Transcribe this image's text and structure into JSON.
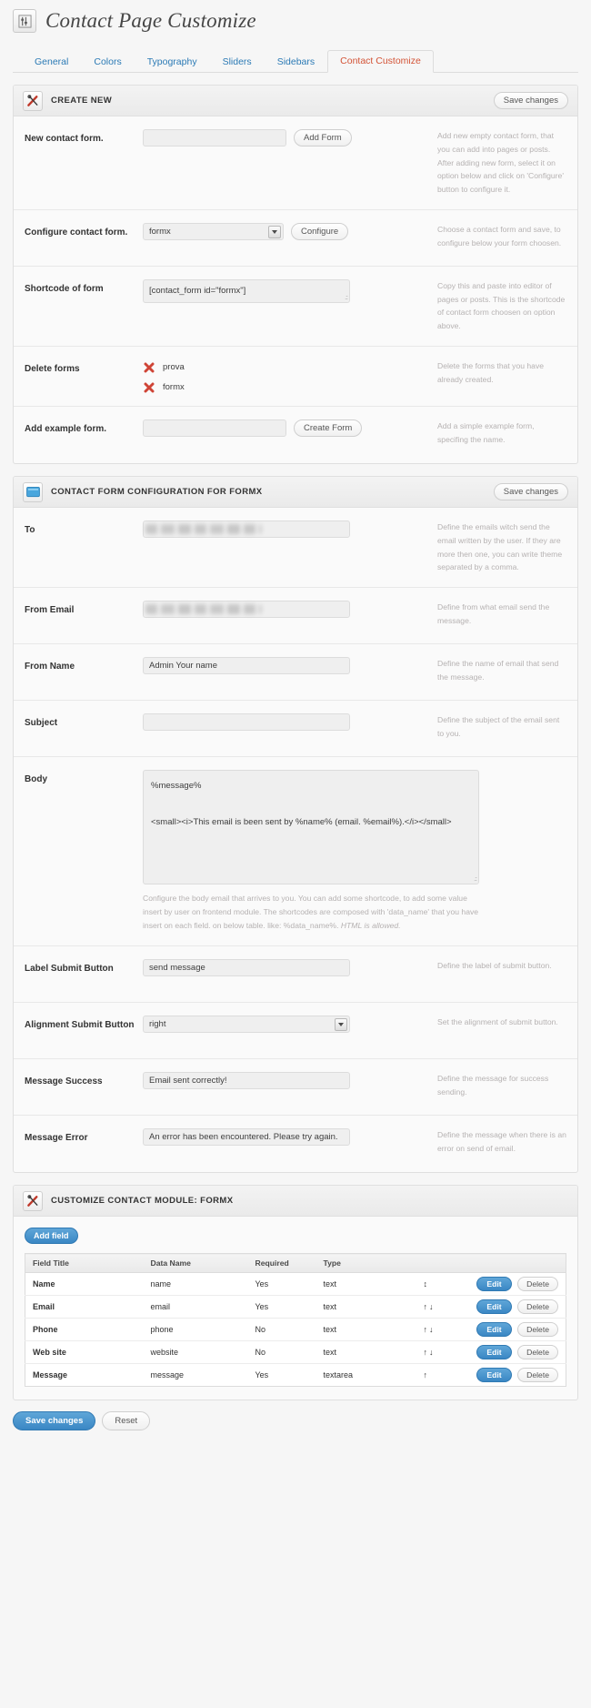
{
  "header": {
    "title": "Contact Page Customize",
    "icon": "sliders-icon"
  },
  "tabs": [
    {
      "label": "General",
      "active": false
    },
    {
      "label": "Colors",
      "active": false
    },
    {
      "label": "Typography",
      "active": false
    },
    {
      "label": "Sliders",
      "active": false
    },
    {
      "label": "Sidebars",
      "active": false
    },
    {
      "label": "Contact Customize",
      "active": true
    }
  ],
  "panel_create": {
    "title": "CREATE NEW",
    "icon": "tools-icon",
    "save_label": "Save changes",
    "rows": [
      {
        "label": "New contact form.",
        "input_value": "",
        "button": "Add Form",
        "desc": "Add new empty contact form, that you can add into pages or posts. After adding new form, select it on option below and click on 'Configure' button to configure it."
      },
      {
        "label": "Configure contact form.",
        "select_value": "formx",
        "button": "Configure",
        "desc": "Choose a contact form and save, to configure below your form choosen."
      },
      {
        "label": "Shortcode of form",
        "shortcode": "[contact_form id=\"formx\"]",
        "desc": "Copy this and paste into editor of pages or posts. This is the shortcode of contact form choosen on option above."
      },
      {
        "label": "Delete forms",
        "forms": [
          "prova",
          "formx"
        ],
        "desc": "Delete the forms that you have already created."
      },
      {
        "label": "Add example form.",
        "input_value": "",
        "button": "Create Form",
        "desc": "Add a simple example form, specifing the name."
      }
    ]
  },
  "panel_config": {
    "title": "CONTACT FORM CONFIGURATION FOR FORMX",
    "icon": "window-icon",
    "save_label": "Save changes",
    "rows": {
      "to": {
        "label": "To",
        "value": "",
        "redacted": true,
        "desc": "Define the emails witch send the email written by the user. If they are more then one, you can write theme separated by a comma."
      },
      "from_email": {
        "label": "From Email",
        "value": "",
        "redacted": true,
        "desc": "Define from what email send the message."
      },
      "from_name": {
        "label": "From Name",
        "value": "Admin Your name",
        "desc": "Define the name of email that send the message."
      },
      "subject": {
        "label": "Subject",
        "value": "",
        "desc": "Define the subject of the email sent to you."
      },
      "body": {
        "label": "Body",
        "value": "%message%\n\n<small><i>This email is been sent by %name% (email. %email%).</i></small>",
        "help": "Configure the body email that arrives to you. You can add some shortcode, to add some value insert by user on frontend module. The shortcodes are composed with 'data_name' that you have insert on each field. on below table. like: %data_name%.",
        "help_italic": "HTML is allowed."
      },
      "label_submit": {
        "label": "Label Submit Button",
        "value": "send message",
        "desc": "Define the label of submit button."
      },
      "alignment_submit": {
        "label": "Alignment Submit Button",
        "value": "right",
        "desc": "Set the alignment of submit button."
      },
      "message_success": {
        "label": "Message Success",
        "value": "Email sent correctly!",
        "desc": "Define the message for success sending."
      },
      "message_error": {
        "label": "Message Error",
        "value": "An error has been encountered. Please try again.",
        "desc": "Define the message when there is an error on send of email."
      }
    }
  },
  "panel_module": {
    "title": "CUSTOMIZE CONTACT MODULE: FORMX",
    "icon": "tools-icon",
    "add_field_label": "Add field",
    "table": {
      "columns": [
        "Field Title",
        "Data Name",
        "Required",
        "Type"
      ],
      "edit_label": "Edit",
      "delete_label": "Delete",
      "rows": [
        {
          "title": "Name",
          "data_name": "name",
          "required": "Yes",
          "type": "text",
          "sort": "↕"
        },
        {
          "title": "Email",
          "data_name": "email",
          "required": "Yes",
          "type": "text",
          "sort": "↑↓"
        },
        {
          "title": "Phone",
          "data_name": "phone",
          "required": "No",
          "type": "text",
          "sort": "↑↓"
        },
        {
          "title": "Web site",
          "data_name": "website",
          "required": "No",
          "type": "text",
          "sort": "↑↓"
        },
        {
          "title": "Message",
          "data_name": "message",
          "required": "Yes",
          "type": "textarea",
          "sort": "↑"
        }
      ]
    }
  },
  "footer": {
    "save_label": "Save changes",
    "reset_label": "Reset"
  },
  "colors": {
    "accent_blue": "#3a87c4",
    "tab_link": "#2b7ab5",
    "tab_active": "#d35336",
    "delete_x": "#cf4436"
  }
}
